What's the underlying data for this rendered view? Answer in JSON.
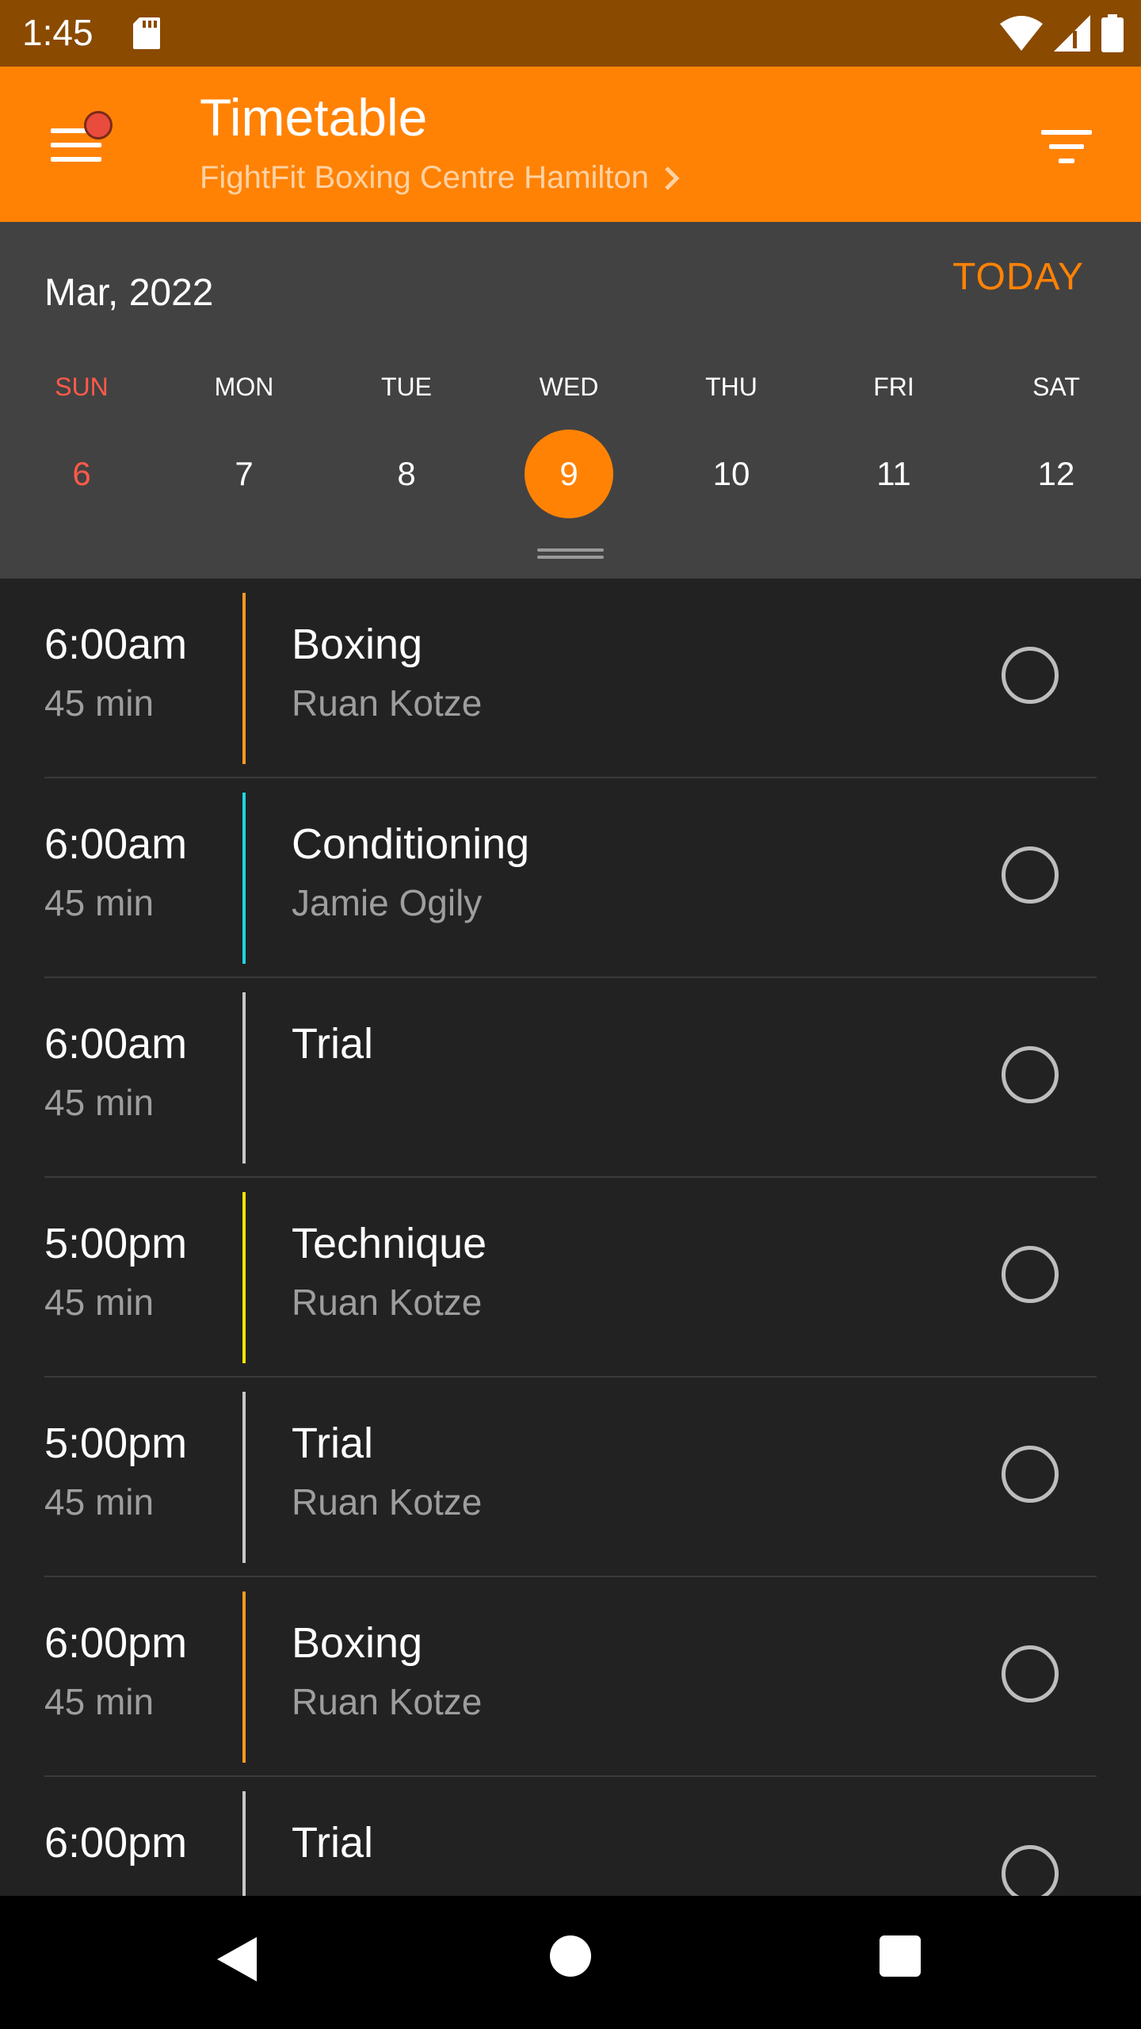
{
  "status_bar": {
    "time": "1:45",
    "icons": [
      "sd-card-icon",
      "wifi-icon",
      "signal-icon",
      "battery-icon"
    ]
  },
  "app_bar": {
    "title": "Timetable",
    "subtitle": "FightFit Boxing Centre Hamilton",
    "accent_color": "#ff8205",
    "notification_dot_color": "#e94b3c"
  },
  "calendar": {
    "month": "Mar, 2022",
    "today_label": "TODAY",
    "days": [
      {
        "weekday": "SUN",
        "date": "6",
        "selected": false
      },
      {
        "weekday": "MON",
        "date": "7",
        "selected": false
      },
      {
        "weekday": "TUE",
        "date": "8",
        "selected": false
      },
      {
        "weekday": "WED",
        "date": "9",
        "selected": true
      },
      {
        "weekday": "THU",
        "date": "10",
        "selected": false
      },
      {
        "weekday": "FRI",
        "date": "11",
        "selected": false
      },
      {
        "weekday": "SAT",
        "date": "12",
        "selected": false
      }
    ]
  },
  "classes": [
    {
      "time": "6:00am",
      "duration": "45 min",
      "name": "Boxing",
      "instructor": "Ruan Kotze",
      "color": "#ff9a1f"
    },
    {
      "time": "6:00am",
      "duration": "45 min",
      "name": "Conditioning",
      "instructor": "Jamie Ogily",
      "color": "#22d3e0"
    },
    {
      "time": "6:00am",
      "duration": "45 min",
      "name": "Trial",
      "instructor": "",
      "color": "#c8c8c8"
    },
    {
      "time": "5:00pm",
      "duration": "45 min",
      "name": "Technique",
      "instructor": "Ruan Kotze",
      "color": "#f2e600"
    },
    {
      "time": "5:00pm",
      "duration": "45 min",
      "name": "Trial",
      "instructor": "Ruan Kotze",
      "color": "#c8c8c8"
    },
    {
      "time": "6:00pm",
      "duration": "45 min",
      "name": "Boxing",
      "instructor": "Ruan Kotze",
      "color": "#ff9a1f"
    },
    {
      "time": "6:00pm",
      "duration": "",
      "name": "Trial",
      "instructor": "",
      "color": "#c8c8c8"
    }
  ],
  "nav_bar": {
    "icons": [
      "back-icon",
      "home-icon",
      "recents-icon"
    ]
  }
}
